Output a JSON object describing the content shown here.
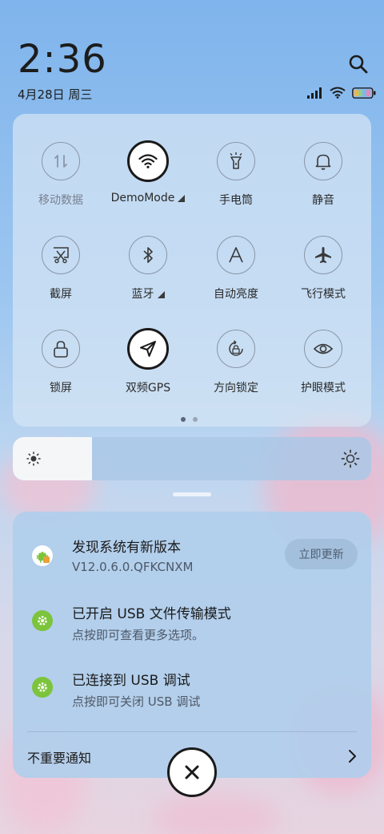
{
  "status": {
    "time": "2:36",
    "date": "4月28日 周三"
  },
  "quick_settings": {
    "tiles": [
      {
        "label": "移动数据",
        "icon": "mobile-data-icon",
        "active": false
      },
      {
        "label": "DemoMode",
        "icon": "wifi-icon",
        "active": true,
        "has_menu": true
      },
      {
        "label": "手电筒",
        "icon": "flashlight-icon",
        "active": false
      },
      {
        "label": "静音",
        "icon": "bell-icon",
        "active": false
      },
      {
        "label": "截屏",
        "icon": "screenshot-icon",
        "active": false
      },
      {
        "label": "蓝牙",
        "icon": "bluetooth-icon",
        "active": false,
        "has_menu": true
      },
      {
        "label": "自动亮度",
        "icon": "auto-brightness-icon",
        "active": false
      },
      {
        "label": "飞行模式",
        "icon": "airplane-icon",
        "active": false
      },
      {
        "label": "锁屏",
        "icon": "lock-icon",
        "active": false
      },
      {
        "label": "双频GPS",
        "icon": "location-arrow-icon",
        "active": true
      },
      {
        "label": "方向锁定",
        "icon": "rotation-lock-icon",
        "active": false
      },
      {
        "label": "护眼模式",
        "icon": "eye-icon",
        "active": false
      }
    ],
    "page_count": 2,
    "current_page": 1
  },
  "brightness": {
    "level": 0.22
  },
  "notifications": [
    {
      "title": "发现系统有新版本",
      "subtitle": "V12.0.6.0.QFKCNXM",
      "action": "立即更新",
      "icon": "android-update-icon"
    },
    {
      "title": "已开启 USB 文件传输模式",
      "subtitle": "点按即可查看更多选项。",
      "icon": "settings-gear-icon"
    },
    {
      "title": "已连接到 USB 调试",
      "subtitle": "点按即可关闭 USB 调试",
      "icon": "settings-gear-icon"
    }
  ],
  "footer": {
    "unimportant_label": "不重要通知"
  },
  "colors": {
    "accent_green": "#7cc43c",
    "panel_bg": "#b0ceec",
    "text_primary": "#1a1a1a"
  }
}
